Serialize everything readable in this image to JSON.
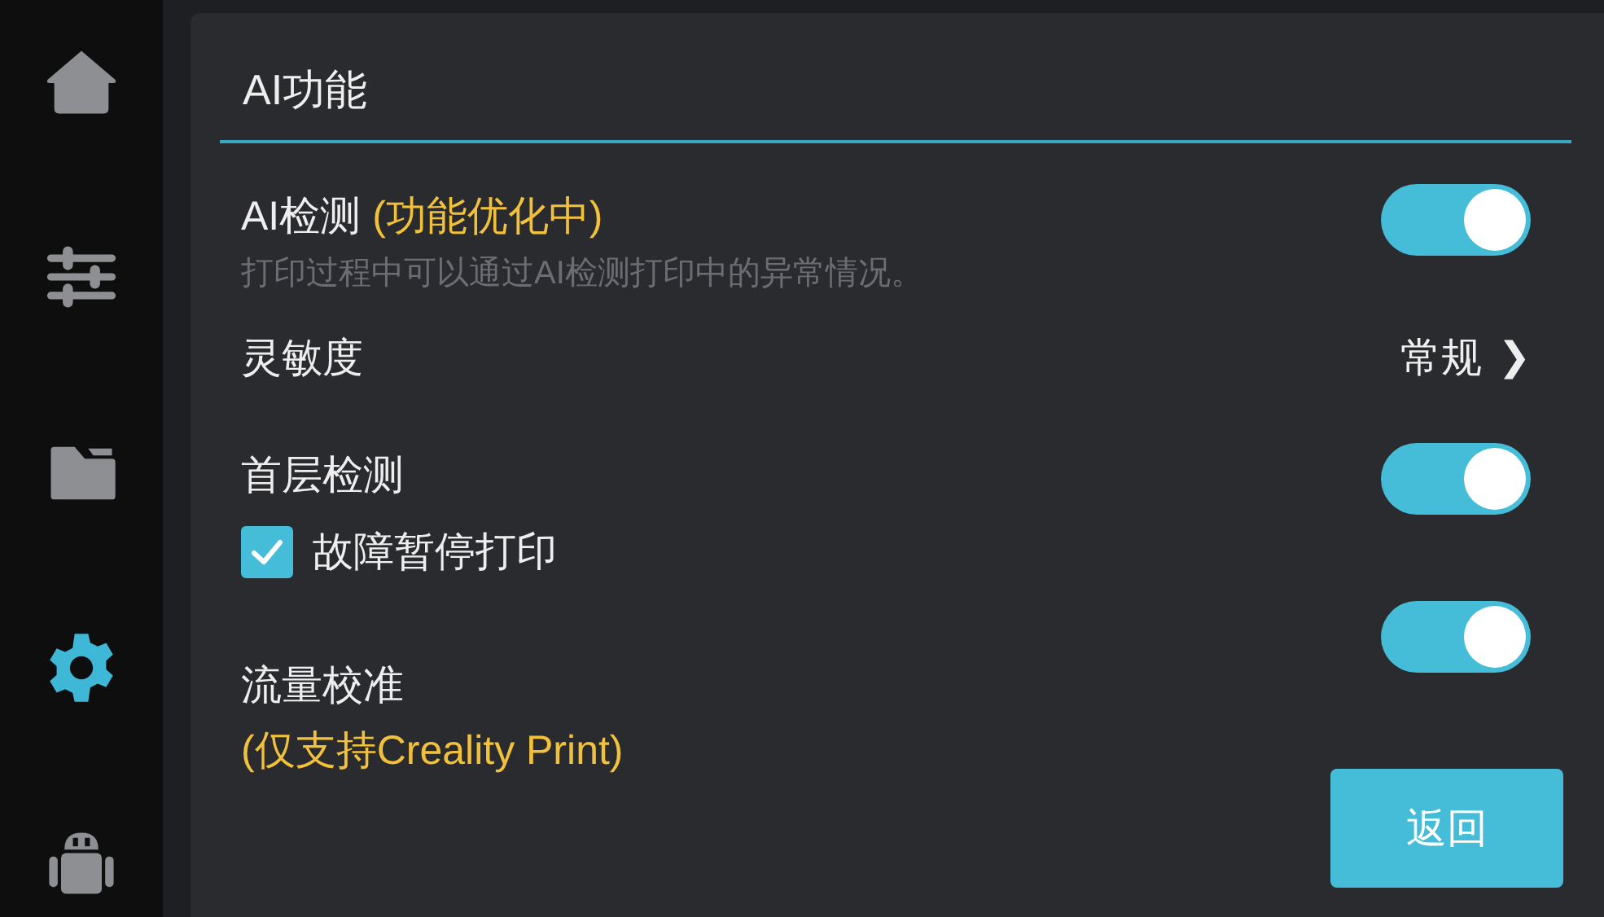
{
  "sidebar": {
    "items": [
      {
        "kind": "home",
        "selected": false
      },
      {
        "kind": "sliders",
        "selected": false
      },
      {
        "kind": "folder",
        "selected": false
      },
      {
        "kind": "gear",
        "selected": true
      },
      {
        "kind": "robot",
        "selected": false
      }
    ]
  },
  "panel": {
    "title": "AI功能",
    "settings": [
      {
        "kind": "toggle",
        "label": "AI检测",
        "note": "(功能优化中)",
        "note_below": false,
        "description": "打印过程中可以通过AI检测打印中的异常情况。",
        "on": true
      },
      {
        "kind": "select",
        "label": "灵敏度",
        "value": "常规",
        "chevron": "❯"
      },
      {
        "kind": "toggle",
        "label": "首层检测",
        "on": true
      },
      {
        "kind": "checkbox",
        "label": "故障暂停打印",
        "checked": true
      },
      {
        "kind": "toggle",
        "label": "流量校准",
        "note": "(仅支持Creality Print)",
        "note_below": true,
        "on": true
      }
    ],
    "back_button": "返回"
  }
}
